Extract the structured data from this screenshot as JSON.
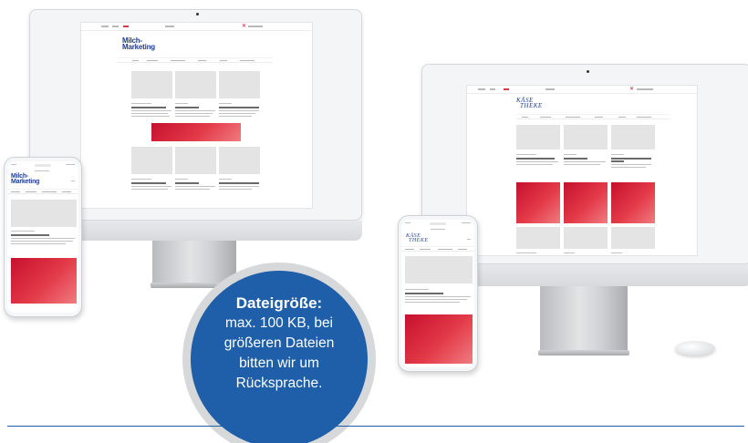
{
  "badge": {
    "title": "Dateigröße:",
    "lines": [
      "max. 100 KB, bei",
      "größeren Dateien",
      "bitten wir um",
      "Rücksprache."
    ]
  },
  "sites": {
    "milch_marketing": {
      "logo_line1": "Milch-",
      "logo_line2": "Marketing"
    },
    "kaese_theke": {
      "logo_line1": "KÄSE",
      "logo_line2": "THEKE"
    }
  },
  "colors": {
    "accent_blue": "#1f5ea8",
    "ad_red": "#c6102e",
    "logo_blue": "#1d3f8f"
  }
}
